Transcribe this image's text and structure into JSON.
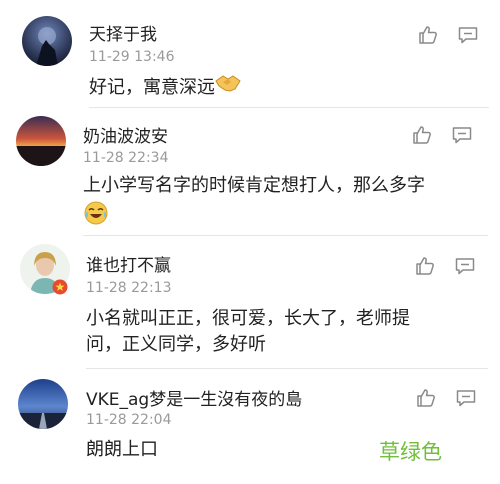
{
  "comments": [
    {
      "name": "天择于我",
      "time": "11-29 13:46",
      "text": "好记，寓意深远",
      "emoji": "handshake-emoji"
    },
    {
      "name": "奶油波波安",
      "time": "11-28 22:34",
      "text": "上小学写名字的时候肯定想打人，那么多字",
      "emoji": "crying-laughing-emoji"
    },
    {
      "name": "谁也打不赢",
      "time": "11-28 22:13",
      "text_line1": "小名就叫正正，很可爱，长大了，老师提",
      "text_line2": "问，正义同学，多好听"
    },
    {
      "name": "VKE_ag梦是一生沒有夜的島",
      "time": "11-28 22:04",
      "text": "朗朗上口"
    }
  ],
  "watermark": "草绿色",
  "icons": {
    "like": "thumbs-up-icon",
    "comment": "comment-icon"
  },
  "colors": {
    "watermark": "#6fbf3a",
    "time": "#9a9a9a",
    "divider": "#e6e6e6"
  }
}
